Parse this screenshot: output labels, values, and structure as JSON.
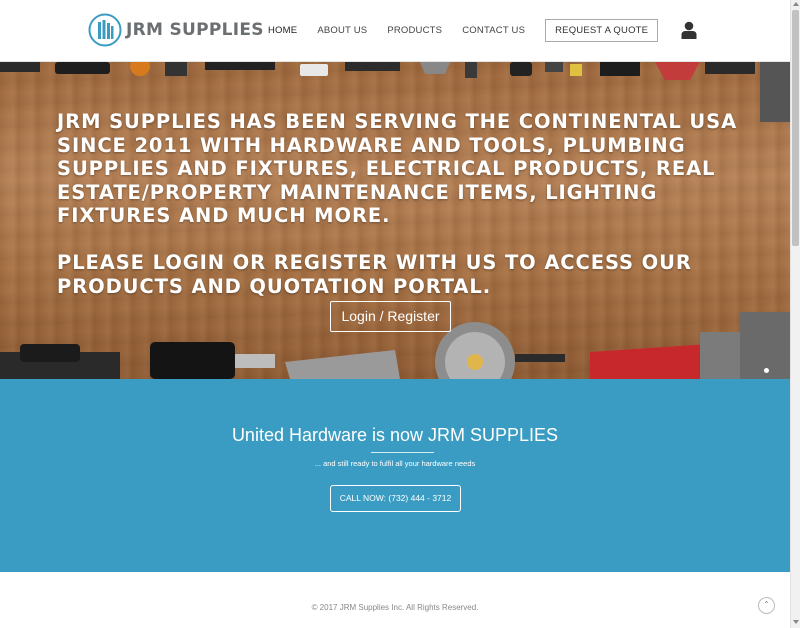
{
  "brand": {
    "name": "JRM SUPPLIES",
    "logo_color": "#3a9cc2"
  },
  "nav": {
    "items": [
      {
        "label": "HOME",
        "active": true
      },
      {
        "label": "ABOUT US",
        "active": false
      },
      {
        "label": "PRODUCTS",
        "active": false
      },
      {
        "label": "CONTACT US",
        "active": false
      }
    ],
    "quote_label": "REQUEST A QUOTE",
    "user_icon": "user-icon"
  },
  "hero": {
    "paragraph_1": "JRM SUPPLIES HAS BEEN SERVING THE CONTINENTAL USA SINCE 2011 WITH HARDWARE AND TOOLS, PLUMBING SUPPLIES AND FIXTURES, ELECTRICAL PRODUCTS, REAL ESTATE/PROPERTY MAINTENANCE ITEMS, LIGHTING FIXTURES AND MUCH MORE.",
    "paragraph_2": "PLEASE LOGIN OR REGISTER WITH US TO ACCESS OUR PRODUCTS AND QUOTATION PORTAL.",
    "login_button": "Login / Register"
  },
  "band": {
    "title": "United Hardware is now JRM SUPPLIES",
    "subtitle": "... and still ready to fulfil all your hardware needs",
    "call_button": "CALL NOW: (732) 444 - 3712",
    "background": "#3a9cc2"
  },
  "footer": {
    "copyright": "© 2017 JRM Supplies Inc. All Rights Reserved.",
    "top_icon": "chevron-up-icon"
  }
}
